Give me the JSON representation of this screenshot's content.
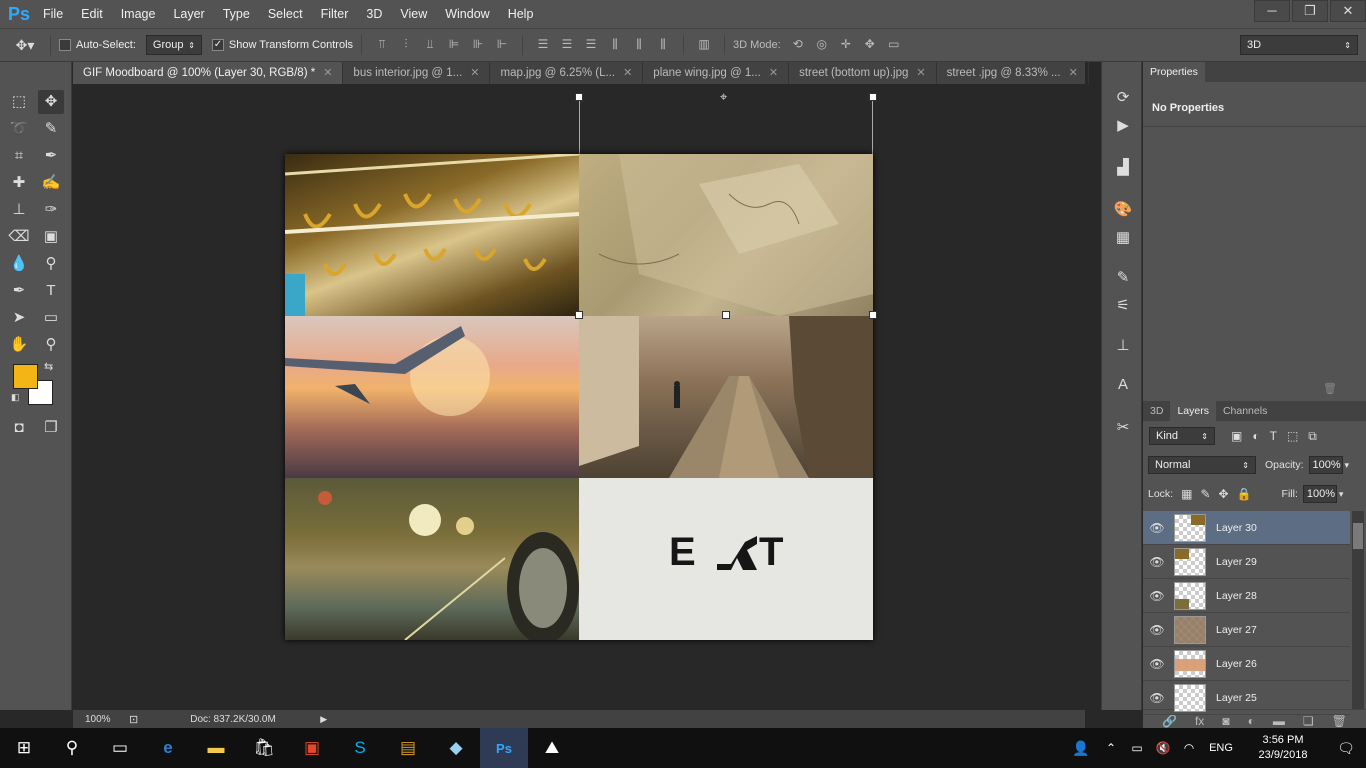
{
  "app": {
    "logo": "Ps"
  },
  "menu": [
    "File",
    "Edit",
    "Image",
    "Layer",
    "Type",
    "Select",
    "Filter",
    "3D",
    "View",
    "Window",
    "Help"
  ],
  "window_controls": [
    "─",
    "❐",
    "✕"
  ],
  "options": {
    "auto_select_label": "Auto-Select:",
    "auto_select_checked": false,
    "auto_select_target": "Group",
    "show_transform_label": "Show Transform Controls",
    "show_transform_checked": true,
    "mode_3d_label": "3D Mode:",
    "workspace": "3D"
  },
  "tabs": [
    {
      "label": "GIF Moodboard @ 100% (Layer 30, RGB/8) *",
      "active": true
    },
    {
      "label": "bus interior.jpg @ 1...",
      "active": false
    },
    {
      "label": "map.jpg @ 6.25% (L...",
      "active": false
    },
    {
      "label": "plane wing.jpg @ 1...",
      "active": false
    },
    {
      "label": "street (bottom up).jpg",
      "active": false
    },
    {
      "label": "street .jpg @ 8.33% ...",
      "active": false
    }
  ],
  "colors": {
    "foreground": "#f2b515",
    "background": "#ffffff",
    "accent": "#31a8ff",
    "selected_layer": "#5d6d84"
  },
  "canvas": {
    "exit_text_left": "E",
    "exit_text_right": "T"
  },
  "status": {
    "zoom": "100%",
    "doc": "Doc: 837.2K/30.0M"
  },
  "properties": {
    "tab": "Properties",
    "content": "No Properties"
  },
  "layers_panel": {
    "tabs": [
      "3D",
      "Layers",
      "Channels"
    ],
    "active_tab": "Layers",
    "filter": "Kind",
    "blend_mode": "Normal",
    "opacity_label": "Opacity:",
    "opacity": "100%",
    "lock_label": "Lock:",
    "fill_label": "Fill:",
    "fill": "100%",
    "layers": [
      {
        "name": "Layer 30",
        "selected": true
      },
      {
        "name": "Layer 29",
        "selected": false
      },
      {
        "name": "Layer 28",
        "selected": false
      },
      {
        "name": "Layer 27",
        "selected": false
      },
      {
        "name": "Layer 26",
        "selected": false
      },
      {
        "name": "Layer 25",
        "selected": false
      }
    ]
  },
  "taskbar": {
    "time": "3:56 PM",
    "date": "23/9/2018",
    "lang": "ENG"
  }
}
